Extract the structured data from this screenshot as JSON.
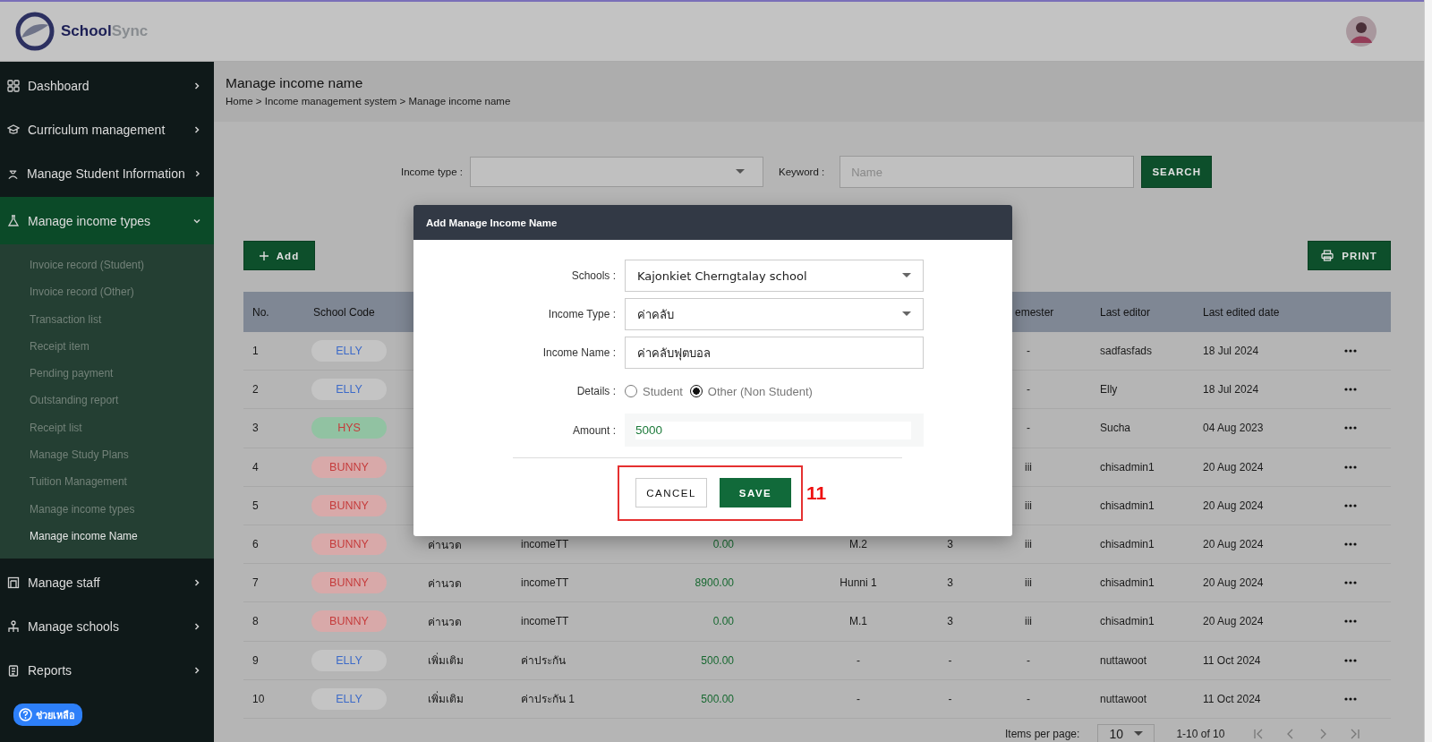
{
  "header": {
    "brand_name": "School",
    "brand_suffix": "Sync"
  },
  "sidebar": {
    "items": [
      {
        "label": "Dashboard",
        "expanded": false
      },
      {
        "label": "Curriculum management",
        "expanded": false
      },
      {
        "label": "Manage Student Information",
        "expanded": false
      },
      {
        "label": "Manage income types",
        "expanded": true,
        "children": [
          {
            "label": "Invoice record (Student)",
            "selected": false
          },
          {
            "label": "Invoice record (Other)",
            "selected": false
          },
          {
            "label": "Transaction list",
            "selected": false
          },
          {
            "label": "Receipt item",
            "selected": false
          },
          {
            "label": "Pending payment",
            "selected": false
          },
          {
            "label": "Outstanding report",
            "selected": false
          },
          {
            "label": "Receipt list",
            "selected": false
          },
          {
            "label": "Manage Study Plans",
            "selected": false
          },
          {
            "label": "Tuition Management",
            "selected": false
          },
          {
            "label": "Manage income types",
            "selected": false
          },
          {
            "label": "Manage income Name",
            "selected": true
          }
        ]
      },
      {
        "label": "Manage staff",
        "expanded": false
      },
      {
        "label": "Manage schools",
        "expanded": false
      },
      {
        "label": "Reports",
        "expanded": false
      }
    ],
    "help_button": "ช่วยเหลือ"
  },
  "page": {
    "title": "Manage income name",
    "breadcrumb": "Home > Income management system > Manage income name"
  },
  "filters": {
    "income_type_label": "Income type :",
    "keyword_label": "Keyword :",
    "keyword_placeholder": "Name",
    "search_button": "SEARCH"
  },
  "add_button": "Add",
  "print_button": "PRINT",
  "table": {
    "columns": [
      "No.",
      "School Code",
      "emester",
      "Last editor",
      "Last edited date"
    ],
    "rows": [
      {
        "no": "1",
        "school_code": {
          "text": "ELLY",
          "color": "#3c6ac8",
          "fill": {
            "color": "#c4c4c4"
          }
        },
        "semester": "-",
        "last_editor": "sadfasfads",
        "last_edited_date": "18 Jul 2024"
      },
      {
        "no": "2",
        "school_code": {
          "text": "ELLY",
          "color": "#3c6ac8",
          "fill": {
            "color": "#c4c4c4"
          }
        },
        "semester": "-",
        "last_editor": "Elly",
        "last_edited_date": "18 Jul 2024"
      },
      {
        "no": "3",
        "school_code": {
          "text": "HYS",
          "color": "#c53b3b",
          "fill": {
            "color": "#91c2a2"
          }
        },
        "semester": "-",
        "last_editor": "Sucha",
        "last_edited_date": "04 Aug 2023"
      },
      {
        "no": "4",
        "school_code": {
          "text": "BUNNY",
          "color": "#c53b3b",
          "fill": {
            "color": "#d8a9a9"
          }
        },
        "semester": "iii",
        "last_editor": "chisadmin1",
        "last_edited_date": "20 Aug 2024"
      },
      {
        "no": "5",
        "school_code": {
          "text": "BUNNY",
          "color": "#c53b3b",
          "fill": {
            "color": "#d8a9a9"
          }
        },
        "semester": "iii",
        "last_editor": "chisadmin1",
        "last_edited_date": "20 Aug 2024"
      },
      {
        "no": "6",
        "school_code": {
          "text": "BUNNY",
          "color": "#c53b3b",
          "fill": {
            "color": "#d8a9a9"
          }
        },
        "column_3": "ค่านวด",
        "column_4": "incomeTT",
        "column_5": "0.00",
        "column_6": "M.2",
        "column_7": "3",
        "semester": "iii",
        "last_editor": "chisadmin1",
        "last_edited_date": "20 Aug 2024"
      },
      {
        "no": "7",
        "school_code": {
          "text": "BUNNY",
          "color": "#c53b3b",
          "fill": {
            "color": "#d8a9a9"
          }
        },
        "column_3": "ค่านวด",
        "column_4": "incomeTT",
        "column_5": "8900.00",
        "column_6": "Hunni 1",
        "column_7": "3",
        "semester": "iii",
        "last_editor": "chisadmin1",
        "last_edited_date": "20 Aug 2024"
      },
      {
        "no": "8",
        "school_code": {
          "text": "BUNNY",
          "color": "#c53b3b",
          "fill": {
            "color": "#d8a9a9"
          }
        },
        "column_3": "ค่านวด",
        "column_4": "incomeTT",
        "column_5": "0.00",
        "column_6": "M.1",
        "column_7": "3",
        "semester": "iii",
        "last_editor": "chisadmin1",
        "last_edited_date": "20 Aug 2024"
      },
      {
        "no": "9",
        "school_code": {
          "text": "ELLY",
          "color": "#3c6ac8",
          "fill": {
            "color": "#c4c4c4"
          }
        },
        "column_3": "เพิ่มเติม",
        "column_4": "ค่าประกัน",
        "column_5": "500.00",
        "column_6": "-",
        "column_7": "-",
        "semester": "-",
        "last_editor": "nuttawoot",
        "last_edited_date": "11 Oct 2024"
      },
      {
        "no": "10",
        "school_code": {
          "text": "ELLY",
          "color": "#3c6ac8",
          "fill": {
            "color": "#c4c4c4"
          }
        },
        "column_3": "เพิ่มเติม",
        "column_4": "ค่าประกัน 1",
        "column_5": "500.00",
        "column_6": "-",
        "column_7": "-",
        "semester": "-",
        "last_editor": "nuttawoot",
        "last_edited_date": "11 Oct 2024"
      }
    ]
  },
  "pagination": {
    "items_per_page_label": "Items per page:",
    "page_size": "10",
    "range": "1-10 of 10"
  },
  "modal": {
    "title": "Add Manage Income Name",
    "fields": [
      {
        "kind": "select",
        "label": "Schools :",
        "value": "Kajonkiet Cherngtalay school"
      },
      {
        "kind": "select",
        "label": "Income Type :",
        "value": "ค่าคลับ"
      },
      {
        "kind": "text",
        "label": "Income Name :",
        "value": "ค่าคลับฟุตบอล"
      },
      {
        "kind": "radio",
        "label": "Details :",
        "options": [
          {
            "label": "Student",
            "selected": false
          },
          {
            "label": "Other (Non Student)",
            "selected": true
          }
        ]
      },
      {
        "kind": "amount",
        "label": "Amount :",
        "value": "5000"
      }
    ],
    "cancel_button": "CANCEL",
    "save_button": "SAVE"
  },
  "annotation": {
    "label": "11"
  }
}
